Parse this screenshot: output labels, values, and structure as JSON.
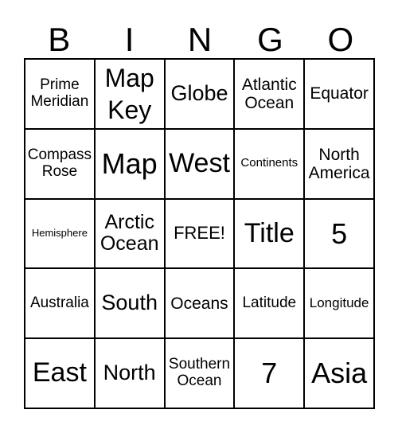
{
  "header": [
    "B",
    "I",
    "N",
    "G",
    "O"
  ],
  "cells": [
    "Prime Meridian",
    "Map Key",
    "Globe",
    "Atlantic Ocean",
    "Equator",
    "Compass Rose",
    "Map",
    "West",
    "Continents",
    "North America",
    "Hemisphere",
    "Arctic Ocean",
    "FREE!",
    "Title",
    "5",
    "Australia",
    "South",
    "Oceans",
    "Latitude",
    "Longitude",
    "East",
    "North",
    "Southern Ocean",
    "7",
    "Asia"
  ]
}
